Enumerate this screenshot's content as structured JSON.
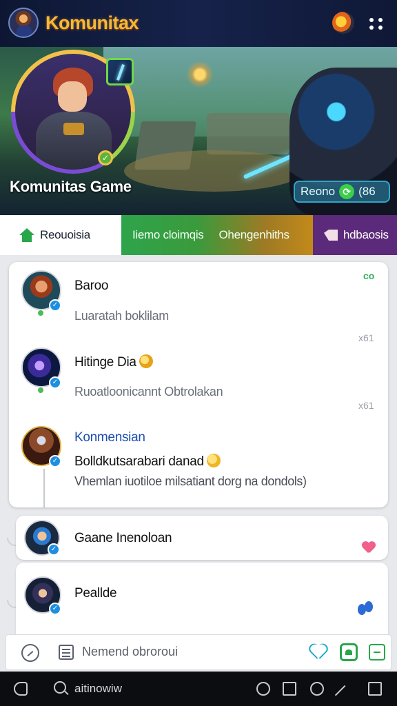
{
  "app": {
    "title": "Komunitax"
  },
  "banner": {
    "title": "Komunitas Game",
    "chip_label": "Reono",
    "chip_count": "(86"
  },
  "tabs": [
    {
      "label": "Reouoisia"
    },
    {
      "label": "Iiemo cloimqis"
    },
    {
      "label": "Ohengenhiths"
    },
    {
      "label": "hdbaosis"
    }
  ],
  "thread": {
    "top_badge": "co",
    "posts": [
      {
        "name": "Baroo",
        "text": "Luaratah boklilam",
        "meta": "x61"
      },
      {
        "name": "Hitinge Dia",
        "text": "Ruoatloonicannt Obtrolakan",
        "meta": "x61"
      },
      {
        "name": "Konmensian",
        "line1": "Bolldkutsarabari danad",
        "line2": "Vhemlan iuotiloe milsatiant dorg na dondols)"
      }
    ]
  },
  "replies": [
    {
      "name": "Gaane Inenoloan"
    },
    {
      "name": "Peallde"
    }
  ],
  "composer": {
    "placeholder": "Nemend obroroui"
  },
  "bottombar": {
    "search_text": "aitinowiw"
  },
  "colors": {
    "accent_green": "#27a64a",
    "title_gold": "#f6b938",
    "verify_blue": "#1e8fe0",
    "link_blue": "#1d4fb0"
  }
}
